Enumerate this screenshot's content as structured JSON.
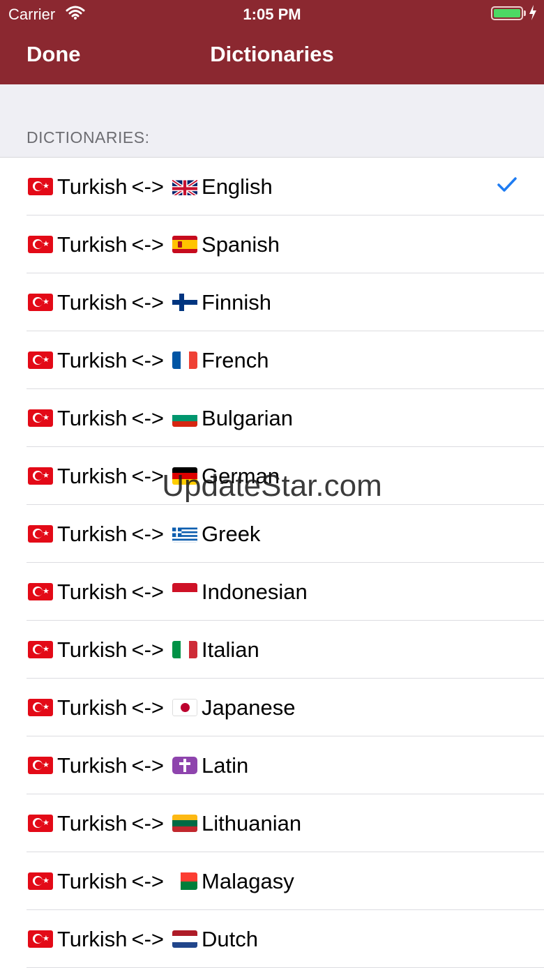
{
  "status_bar": {
    "carrier": "Carrier",
    "time": "1:05 PM"
  },
  "nav": {
    "done_label": "Done",
    "title": "Dictionaries"
  },
  "section_header": "DICTIONARIES:",
  "source_language": "Turkish",
  "separator": "<->",
  "rows": [
    {
      "language": "English",
      "flag": "GB",
      "selected": true
    },
    {
      "language": "Spanish",
      "flag": "ES"
    },
    {
      "language": "Finnish",
      "flag": "FI"
    },
    {
      "language": "French",
      "flag": "FR"
    },
    {
      "language": "Bulgarian",
      "flag": "BG"
    },
    {
      "language": "German",
      "flag": "DE"
    },
    {
      "language": "Greek",
      "flag": "GR"
    },
    {
      "language": "Indonesian",
      "flag": "ID"
    },
    {
      "language": "Italian",
      "flag": "IT"
    },
    {
      "language": "Japanese",
      "flag": "JP"
    },
    {
      "language": "Latin",
      "flag": "cross"
    },
    {
      "language": "Lithuanian",
      "flag": "LT"
    },
    {
      "language": "Malagasy",
      "flag": "MG"
    },
    {
      "language": "Dutch",
      "flag": "NL"
    }
  ],
  "watermark": "UpdateStar.com",
  "colors": {
    "navbar": "#8b2830",
    "checkmark": "#1e7cf2",
    "group_background": "#efeff4",
    "battery": "#4cd964"
  }
}
